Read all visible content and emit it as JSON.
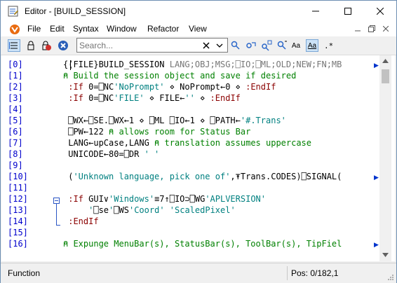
{
  "window": {
    "title": "Editor - [BUILD_SESSION]"
  },
  "menu": [
    "File",
    "Edit",
    "Syntax",
    "Window",
    "Refactor",
    "View"
  ],
  "toolbar": {
    "search_placeholder": "Search...",
    "font_buttons": [
      "Aa",
      "Aa"
    ]
  },
  "editor": {
    "line_numbers": [
      "[0]",
      "[1]",
      "[2]",
      "[3]",
      "[4]",
      "[5]",
      "[6]",
      "[7]",
      "[8]",
      "[9]",
      "[10]",
      "[11]",
      "[12]",
      "[13]",
      "[14]",
      "[15]",
      "[16]"
    ],
    "lines": [
      [
        {
          "t": "{",
          "c": "#000"
        },
        {
          "t": "(FILE}BUILD_SESSION ",
          "c": "#000"
        },
        {
          "t": "LANG;OBJ;MSG;⎕IO;⎕ML;OLD;NEW;FN;MB",
          "c": "#767676"
        }
      ],
      [
        {
          "t": "⍝ Build the session object and save if desired",
          "c": "#008000"
        }
      ],
      [
        {
          "t": " :If ",
          "c": "#8b0000"
        },
        {
          "t": "0=⎕NC",
          "c": "#000"
        },
        {
          "t": "'NoPrompt'",
          "c": "#008080"
        },
        {
          "t": " ⋄ NoPrompt←0 ⋄ ",
          "c": "#000"
        },
        {
          "t": ":EndIf",
          "c": "#8b0000"
        }
      ],
      [
        {
          "t": " :If ",
          "c": "#8b0000"
        },
        {
          "t": "0=⎕NC",
          "c": "#000"
        },
        {
          "t": "'FILE'",
          "c": "#008080"
        },
        {
          "t": " ⋄ FILE←",
          "c": "#000"
        },
        {
          "t": "''",
          "c": "#008080"
        },
        {
          "t": " ⋄ ",
          "c": "#000"
        },
        {
          "t": ":EndIf",
          "c": "#8b0000"
        }
      ],
      [],
      [
        {
          "t": " ⎕WX←⎕SE.⎕WX←1 ⋄ ⎕ML ⎕IO←1 ⋄ ⎕PATH←",
          "c": "#000"
        },
        {
          "t": "'#.Trans'",
          "c": "#008080"
        }
      ],
      [
        {
          "t": " ⎕PW←122 ",
          "c": "#000"
        },
        {
          "t": "⍝ allows room for Status Bar",
          "c": "#008000"
        }
      ],
      [
        {
          "t": " LANG←upCase,LANG ",
          "c": "#000"
        },
        {
          "t": "⍝ translation assumes uppercase",
          "c": "#008000"
        }
      ],
      [
        {
          "t": " UNICODE←80=⎕DR ",
          "c": "#000"
        },
        {
          "t": "' '",
          "c": "#008080"
        }
      ],
      [],
      [
        {
          "t": " (",
          "c": "#000"
        },
        {
          "t": "'Unknown language, pick one of'",
          "c": "#008080"
        },
        {
          "t": ",⍕Trans.CODES)⎕SIGNAL(",
          "c": "#000"
        }
      ],
      [],
      [
        {
          "t": " :If ",
          "c": "#8b0000"
        },
        {
          "t": "GUI∨",
          "c": "#000"
        },
        {
          "t": "'Windows'",
          "c": "#008080"
        },
        {
          "t": "≡7↑⎕IO⊃⎕WG",
          "c": "#000"
        },
        {
          "t": "'APLVERSION'",
          "c": "#008080"
        }
      ],
      [
        {
          "t": "     '",
          "c": "#008080"
        },
        {
          "t": "⎕se",
          "c": "#000"
        },
        {
          "t": "'",
          "c": "#008080"
        },
        {
          "t": "⎕WS",
          "c": "#000"
        },
        {
          "t": "'Coord' 'ScaledPixel'",
          "c": "#008080"
        }
      ],
      [
        {
          "t": " :EndIf",
          "c": "#8b0000"
        }
      ],
      [],
      [
        {
          "t": "⍝ Expunge MenuBar(s), StatusBar(s), ToolBar(s), TipFiel",
          "c": "#008000"
        }
      ]
    ]
  },
  "status": {
    "left": "Function",
    "position": "Pos: 0/182,1"
  },
  "colors": {
    "line_number": "#0000cc",
    "comment": "#008000",
    "string": "#008080",
    "keyword": "#8b0000",
    "fold": "#2a55c4"
  }
}
